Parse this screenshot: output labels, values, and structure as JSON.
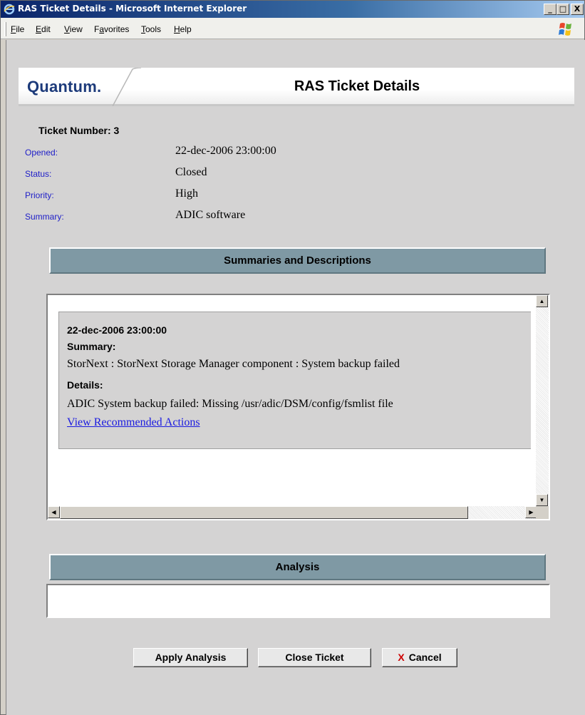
{
  "window": {
    "title": "RAS Ticket Details - Microsoft Internet Explorer",
    "min_glyph": "_",
    "max_glyph": "□",
    "close_glyph": "X"
  },
  "menu": [
    {
      "acc": "F",
      "rest": "ile"
    },
    {
      "acc": "E",
      "rest": "dit"
    },
    {
      "acc": "V",
      "rest": "iew"
    },
    {
      "pre": "F",
      "acc": "a",
      "rest": "vorites"
    },
    {
      "acc": "T",
      "rest": "ools"
    },
    {
      "acc": "H",
      "rest": "elp"
    }
  ],
  "banner": {
    "logo": "Quantum",
    "logo_dot": ".",
    "title": "RAS Ticket Details"
  },
  "ticket": {
    "number_label": "Ticket Number: 3",
    "fields": [
      {
        "label": "Opened:",
        "value": "22-dec-2006 23:00:00"
      },
      {
        "label": "Status:",
        "value": "Closed"
      },
      {
        "label": "Priority:",
        "value": "High"
      },
      {
        "label": "Summary:",
        "value": "ADIC software"
      }
    ]
  },
  "summaries": {
    "header": "Summaries and Descriptions",
    "entry": {
      "date": "22-dec-2006 23:00:00",
      "summary_label": "Summary:",
      "summary_text": "StorNext : StorNext Storage Manager component : System backup failed",
      "details_label": "Details:",
      "details_text": "ADIC System backup failed: Missing /usr/adic/DSM/config/fsmlist file",
      "link": "View Recommended Actions"
    }
  },
  "analysis": {
    "header": "Analysis",
    "value": ""
  },
  "buttons": {
    "apply": "Apply Analysis",
    "close": "Close Ticket",
    "cancel_icon": "X",
    "cancel": "Cancel"
  },
  "colors": {
    "section_header": "#7f99a4",
    "field_label": "#2020c8",
    "link": "#1a1ae0",
    "logo": "#1c3a7a"
  }
}
